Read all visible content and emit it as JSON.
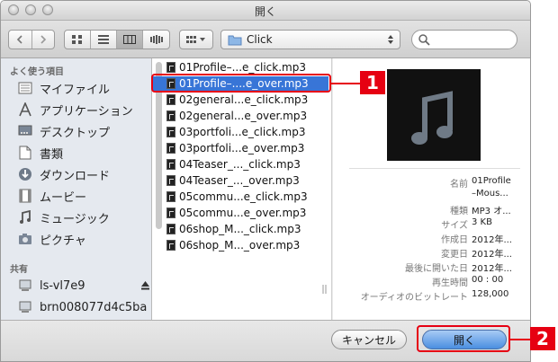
{
  "window": {
    "title": "開く"
  },
  "toolbar": {
    "path": "Click",
    "nav_back_icon": "chevron-left-icon",
    "nav_forward_icon": "chevron-right-icon"
  },
  "sidebar": {
    "favorites_header": "よく使う項目",
    "favorites": [
      {
        "label": "マイファイル",
        "icon": "all-my-files-icon"
      },
      {
        "label": "アプリケーション",
        "icon": "applications-icon"
      },
      {
        "label": "デスクトップ",
        "icon": "desktop-icon"
      },
      {
        "label": "書類",
        "icon": "documents-icon"
      },
      {
        "label": "ダウンロード",
        "icon": "downloads-icon"
      },
      {
        "label": "ムービー",
        "icon": "movies-icon"
      },
      {
        "label": "ミュージック",
        "icon": "music-icon"
      },
      {
        "label": "ピクチャ",
        "icon": "pictures-icon"
      }
    ],
    "shared_header": "共有",
    "shared": [
      {
        "label": "ls-vl7e9",
        "icon": "computer-icon"
      },
      {
        "label": "brn008077d4c5ba",
        "icon": "computer-icon"
      }
    ]
  },
  "files": [
    "01Profile–...e_click.mp3",
    "01Profile–....e_over.mp3",
    "02general...e_click.mp3",
    "02general...e_over.mp3",
    "03portfoli...e_click.mp3",
    "03portfoli...e_over.mp3",
    "04Teaser_..._click.mp3",
    "04Teaser_..._over.mp3",
    "05commu...e_click.mp3",
    "05commu...e_over.mp3",
    "06shop_M..._click.mp3",
    "06shop_M..._over.mp3"
  ],
  "selected_index": 1,
  "preview": {
    "meta": [
      {
        "key": "名前",
        "value": "01Profile"
      },
      {
        "key": "",
        "value": "–Mous..."
      },
      {
        "key": "種類",
        "value": "MP3 オ..."
      },
      {
        "key": "サイズ",
        "value": "3 KB"
      },
      {
        "key": "作成日",
        "value": "2012年..."
      },
      {
        "key": "変更日",
        "value": "2012年..."
      },
      {
        "key": "最後に開いた日",
        "value": "2012年..."
      },
      {
        "key": "再生時間",
        "value": "00 : 00"
      },
      {
        "key": "オーディオのビットレート",
        "value": "128,000"
      }
    ]
  },
  "buttons": {
    "cancel": "キャンセル",
    "open": "開く"
  },
  "callouts": {
    "one": "1",
    "two": "2"
  },
  "colors": {
    "callout": "#e60012",
    "selection": "#3875d7",
    "primary_button": "#4a8ee0"
  }
}
